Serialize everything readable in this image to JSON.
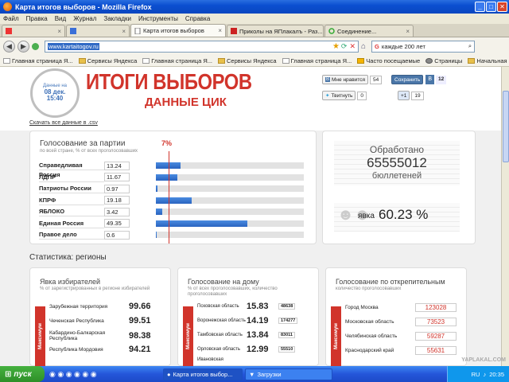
{
  "window": {
    "title": "Карта итогов выборов - Mozilla Firefox",
    "buttons": [
      "_",
      "□",
      "✕"
    ]
  },
  "menu": [
    "Файл",
    "Правка",
    "Вид",
    "Журнал",
    "Закладки",
    "Инструменты",
    "Справка"
  ],
  "tabs": [
    {
      "label": "",
      "active": false
    },
    {
      "label": "",
      "active": false
    },
    {
      "label": "Карта итогов выборов",
      "active": true
    },
    {
      "label": "Приколы на ЯПлакалъ - Раз...",
      "active": false
    },
    {
      "label": "Соединение...",
      "active": false
    }
  ],
  "nav": {
    "back": "◀",
    "forward": "▶",
    "url": "www.kartaitogov.ru",
    "search_text": "каждые 200 лет"
  },
  "bookmarks": [
    "Главная страница Я...",
    "Сервисы Яндекса",
    "Главная страница Я...",
    "Сервисы Яндекса",
    "Главная страница Я...",
    "Часто посещаемые",
    "Страницы",
    "Начальная страница"
  ],
  "page": {
    "clock": {
      "line1": "Данные на",
      "date": "08 дек.",
      "time": "15:40"
    },
    "hero_title": "ИТОГИ ВЫБОРОВ",
    "hero_subtitle": "ДАННЫЕ ЦИК",
    "csv_link": "Скачать все данные в .csv",
    "social": {
      "vk_like": "Мне нравится",
      "vk_count": "54",
      "save": "Сохранить",
      "save_count": "12",
      "tweet": "Твитнуть",
      "tweet_count": "0",
      "plus": "+1",
      "plus_count": "19"
    },
    "party_panel": {
      "title": "Голосование за партии",
      "subtitle": "по всей стране, % от всех проголосовавших",
      "threshold": "7%",
      "threshold_value": 7,
      "scale_max": 80
    },
    "processed": {
      "label_top": "Обработано",
      "number": "65555012",
      "label_bottom": "бюллетеней",
      "turnout_label": "явка",
      "turnout_value": "60.23 %"
    },
    "stats_title": "Статистика: регионы",
    "panels": [
      {
        "title": "Явка избирателей",
        "subtitle": "% от зарегистрированных в регионе избирателей",
        "tab": "Максимум",
        "rows": [
          {
            "name": "Зарубежная территория",
            "value": "99.66"
          },
          {
            "name": "Чеченская Республика",
            "value": "99.51"
          },
          {
            "name": "Кабардино-Балкарская Республика",
            "value": "98.38"
          },
          {
            "name": "Республика Мордовия",
            "value": "94.21"
          }
        ]
      },
      {
        "title": "Голосование на дому",
        "subtitle": "% от всех проголосовавших, количество проголосовавших",
        "tab": "Максимум",
        "rows": [
          {
            "name": "Псковская область",
            "value": "15.83",
            "count": "48638"
          },
          {
            "name": "Воронежская область",
            "value": "14.19",
            "count": "174277"
          },
          {
            "name": "Тамбовская область",
            "value": "13.84",
            "count": "83011"
          },
          {
            "name": "Орловская область",
            "value": "12.99",
            "count": "55510"
          },
          {
            "name": "Ивановская",
            "value": "",
            "count": ""
          }
        ]
      },
      {
        "title": "Голосование по открепительным",
        "subtitle": "количество проголосовавших",
        "tab": "Максимум",
        "rows": [
          {
            "name": "Город Москва",
            "count": "123028"
          },
          {
            "name": "Московская область",
            "count": "73523"
          },
          {
            "name": "Челябинская область",
            "count": "59287"
          },
          {
            "name": "Краснодарский край",
            "count": "55631"
          }
        ]
      }
    ]
  },
  "parties": [
    {
      "name": "Справедливая Россия",
      "value": 13.24,
      "label": "13.24"
    },
    {
      "name": "ЛДПР",
      "value": 11.67,
      "label": "11.67"
    },
    {
      "name": "Патриоты России",
      "value": 0.97,
      "label": "0.97"
    },
    {
      "name": "КПРФ",
      "value": 19.18,
      "label": "19.18"
    },
    {
      "name": "ЯБЛОКО",
      "value": 3.42,
      "label": "3.42"
    },
    {
      "name": "Единая Россия",
      "value": 49.35,
      "label": "49.35"
    },
    {
      "name": "Правое дело",
      "value": 0.6,
      "label": "0.6"
    }
  ],
  "taskbar": {
    "start": "пуск",
    "items": [
      "Карта итогов выбор...",
      "Загрузки"
    ],
    "lang": "RU",
    "time": "20:35"
  },
  "watermark": "YAPLAKAL.COM",
  "colors": {
    "brand_red": "#d1342b",
    "bar_blue": "#2a64c0",
    "xp_blue": "#2456d9"
  }
}
